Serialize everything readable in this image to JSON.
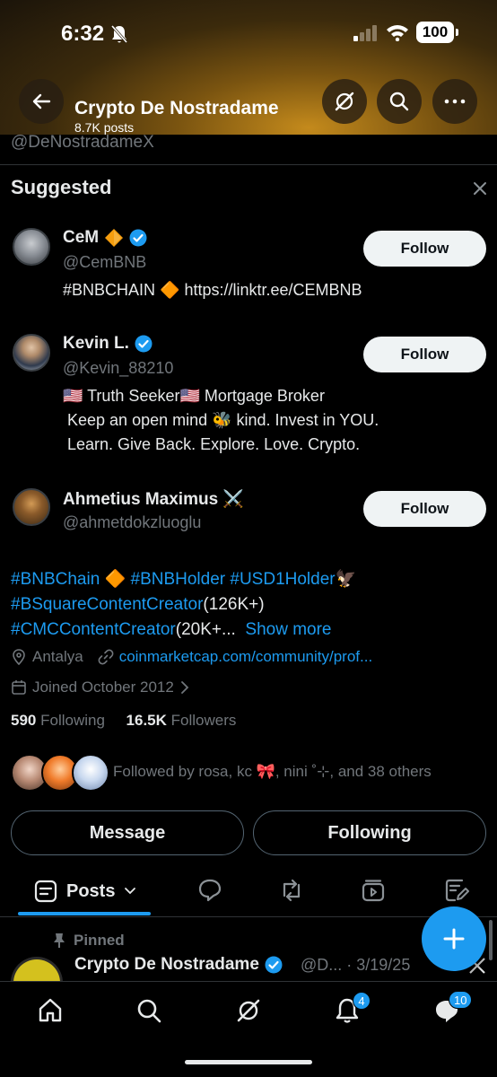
{
  "status_bar": {
    "time": "6:32",
    "battery": "100"
  },
  "header": {
    "title": "Crypto De Nostradame",
    "posts_count": "8.7K posts"
  },
  "profile": {
    "handle": "@DeNostradameX",
    "bio_lines": [
      {
        "parts": [
          "#BNBChain",
          " 🔶 ",
          "#BNBHolder",
          " ",
          "#USD1Holder",
          "🦅"
        ]
      },
      {
        "parts": [
          "#BSquareContentCreator",
          "(126K+)"
        ]
      },
      {
        "parts": [
          "#CMCContentCreator",
          "(20K+...",
          "Show more"
        ]
      }
    ],
    "location": "Antalya",
    "website": "coinmarketcap.com/community/prof...",
    "joined": "Joined October 2012",
    "following_count": "590",
    "following_label": "Following",
    "followers_count": "16.5K",
    "followers_label": "Followers",
    "followed_by": "Followed by rosa, kc 🎀, nini ˚⊹, and 38 others"
  },
  "suggested": {
    "title": "Suggested",
    "users": [
      {
        "name": "CeM",
        "handle": "@CemBNB",
        "bio": "#BNBCHAIN 🔶 https://linktr.ee/CEMBNB",
        "follow_label": "Follow"
      },
      {
        "name": "Kevin L.",
        "handle": "@Kevin_88210",
        "bio": "🇺🇸 Truth Seeker🇺🇸 Mortgage Broker\n Keep an open mind 🐝 kind. Invest in YOU.\n Learn. Give Back. Explore. Love. Crypto.",
        "follow_label": "Follow"
      },
      {
        "name": "Ahmetius Maximus ⚔️",
        "handle": "@ahmetdokzluoglu",
        "bio": "",
        "follow_label": "Follow"
      }
    ]
  },
  "actions": {
    "message_label": "Message",
    "following_label": "Following"
  },
  "tabs": {
    "posts_label": "Posts"
  },
  "pinned_post": {
    "pinned_label": "Pinned",
    "author": "Crypto De Nostradame",
    "meta": "@D... · 3/19/25"
  },
  "bottom_nav": {
    "notifications_badge": "4",
    "messages_badge": "10"
  },
  "colors": {
    "accent": "#1d9bf0",
    "background": "#000000",
    "muted": "#71767b",
    "text": "#e7e9ea"
  }
}
